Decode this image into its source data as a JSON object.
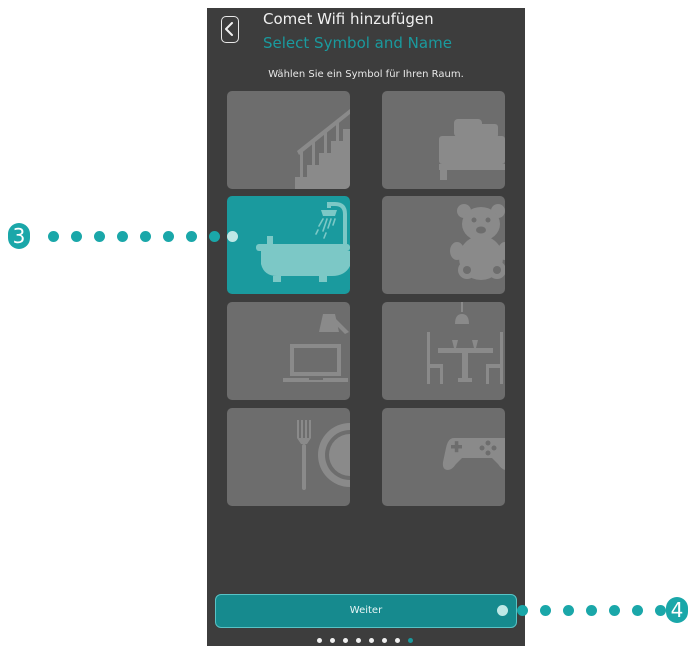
{
  "header": {
    "title": "Comet Wifi hinzufügen",
    "subtitle": "Select Symbol and Name",
    "back_icon": "chevron-left-icon"
  },
  "instruction": "Wählen Sie ein Symbol für Ihren Raum.",
  "room_symbols": [
    {
      "icon": "stairs-icon",
      "selected": false
    },
    {
      "icon": "bed-icon",
      "selected": false
    },
    {
      "icon": "bathtub-icon",
      "selected": true
    },
    {
      "icon": "teddy-bear-icon",
      "selected": false
    },
    {
      "icon": "desk-laptop-icon",
      "selected": false
    },
    {
      "icon": "dining-table-icon",
      "selected": false
    },
    {
      "icon": "plate-fork-icon",
      "selected": false
    },
    {
      "icon": "gamepad-icon",
      "selected": false
    }
  ],
  "continue_button": {
    "label": "Weiter"
  },
  "pagination": {
    "total": 8,
    "current": 8
  },
  "callouts": [
    {
      "label": "3",
      "target": "bathtub-tile"
    },
    {
      "label": "4",
      "target": "weiter-button"
    }
  ],
  "colors": {
    "background": "#3d3d3d",
    "tile": "#6d6d6d",
    "accent": "#1a9a9e",
    "icon": "#8a8a8a"
  }
}
